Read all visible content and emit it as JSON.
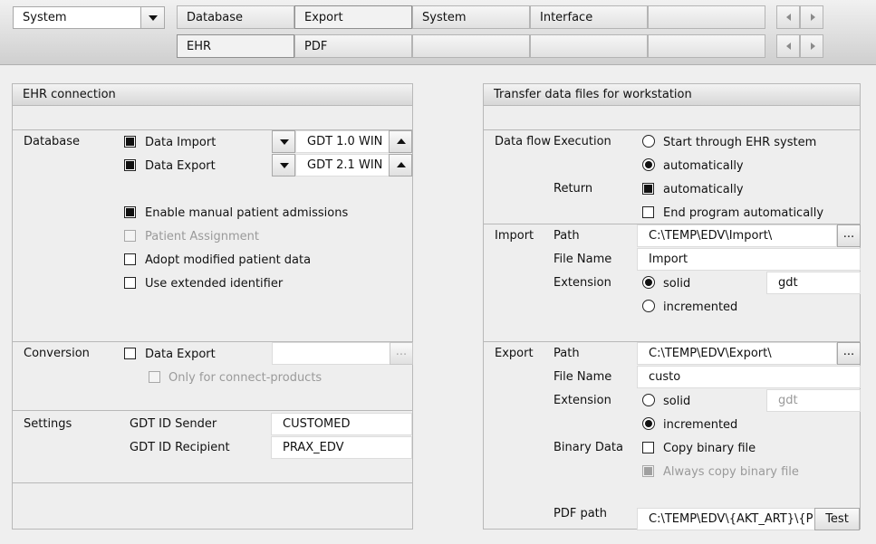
{
  "topbar": {
    "module_select": "System",
    "tabs_row1": [
      "Database",
      "Export",
      "System",
      "Interface",
      ""
    ],
    "tabs_row2": [
      "EHR",
      "PDF",
      "",
      "",
      ""
    ],
    "active_row1": "Export",
    "active_row2": "EHR"
  },
  "left": {
    "title": "EHR connection",
    "database": {
      "label": "Database",
      "data_import": {
        "label": "Data Import",
        "checked": true,
        "value": "GDT 1.0 WIN"
      },
      "data_export": {
        "label": "Data Export",
        "checked": true,
        "value": "GDT 2.1 WIN"
      },
      "enable_manual": {
        "label": "Enable manual patient admissions",
        "checked": true
      },
      "patient_assignment": {
        "label": "Patient Assignment",
        "checked": false,
        "disabled": true
      },
      "adopt_modified": {
        "label": "Adopt modified patient data",
        "checked": false
      },
      "use_extended": {
        "label": "Use extended identifier",
        "checked": false
      }
    },
    "conversion": {
      "label": "Conversion",
      "data_export": {
        "label": "Data Export",
        "checked": false,
        "value": ""
      },
      "only_connect": {
        "label": "Only for connect-products",
        "checked": false,
        "disabled": true
      },
      "browse": "..."
    },
    "settings": {
      "label": "Settings",
      "sender_label": "GDT ID Sender",
      "sender_value": "CUSTOMED",
      "recipient_label": "GDT ID Recipient",
      "recipient_value": "PRAX_EDV"
    }
  },
  "right": {
    "title": "Transfer data files for workstation",
    "dataflow": {
      "label": "Data flow",
      "execution_label": "Execution",
      "start_ehr": {
        "label": "Start through EHR system",
        "selected": false
      },
      "automatically": {
        "label": "automatically",
        "selected": true
      },
      "return_label": "Return",
      "return_auto": {
        "label": "automatically",
        "checked": true
      },
      "end_program": {
        "label": "End program automatically",
        "checked": false
      }
    },
    "import": {
      "label": "Import",
      "path_label": "Path",
      "path_value": "C:\\TEMP\\EDV\\Import\\",
      "filename_label": "File Name",
      "filename_value": "Import",
      "extension_label": "Extension",
      "solid": {
        "label": "solid",
        "selected": true
      },
      "ext_value": "gdt",
      "incremented": {
        "label": "incremented",
        "selected": false
      },
      "browse": "..."
    },
    "export": {
      "label": "Export",
      "path_label": "Path",
      "path_value": "C:\\TEMP\\EDV\\Export\\",
      "filename_label": "File Name",
      "filename_value": "custo",
      "extension_label": "Extension",
      "solid": {
        "label": "solid",
        "selected": false
      },
      "ext_value": "gdt",
      "incremented": {
        "label": "incremented",
        "selected": true
      },
      "binary_label": "Binary Data",
      "copy_binary": {
        "label": "Copy binary file",
        "checked": false
      },
      "always_copy": {
        "label": "Always copy binary file",
        "checked": true,
        "disabled": true
      },
      "pdf_label": "PDF path",
      "pdf_value": "C:\\TEMP\\EDV\\{AKT_ART}\\{P_",
      "test_button": "Test",
      "browse": "..."
    }
  }
}
